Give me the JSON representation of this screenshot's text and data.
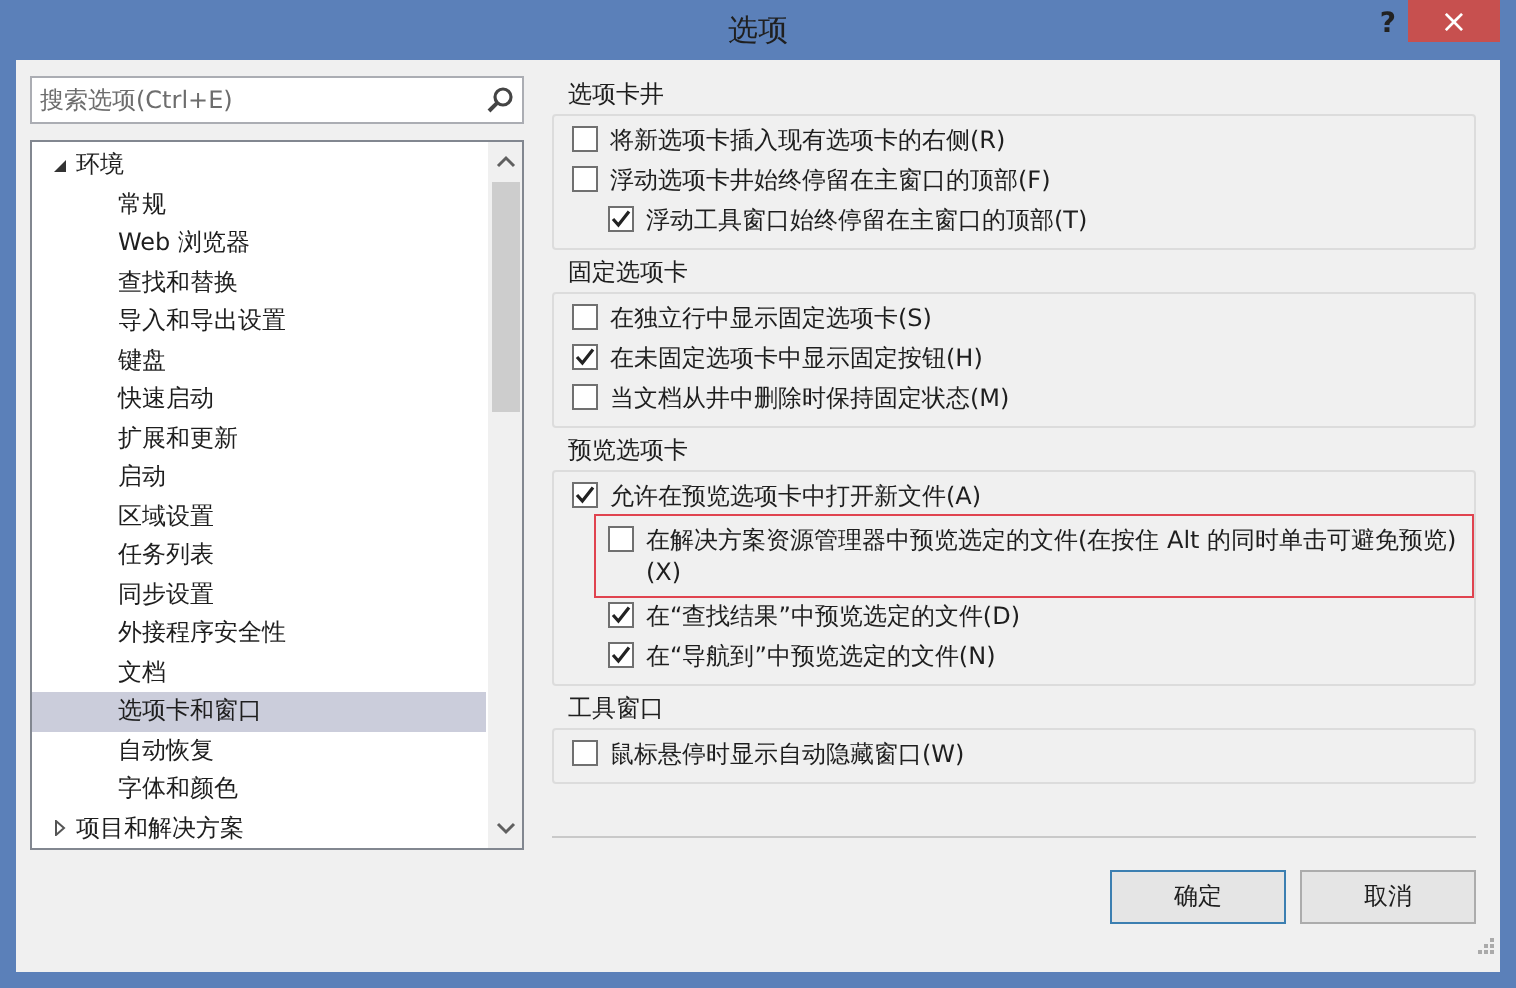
{
  "window": {
    "title": "选项",
    "help": "?",
    "close": "×"
  },
  "search": {
    "placeholder": "搜索选项(Ctrl+E)"
  },
  "tree": [
    {
      "label": "环境",
      "expanded": true,
      "children": [
        {
          "label": "常规",
          "selected": false
        },
        {
          "label": "Web 浏览器",
          "selected": false
        },
        {
          "label": "查找和替换",
          "selected": false
        },
        {
          "label": "导入和导出设置",
          "selected": false
        },
        {
          "label": "键盘",
          "selected": false
        },
        {
          "label": "快速启动",
          "selected": false
        },
        {
          "label": "扩展和更新",
          "selected": false
        },
        {
          "label": "启动",
          "selected": false
        },
        {
          "label": "区域设置",
          "selected": false
        },
        {
          "label": "任务列表",
          "selected": false
        },
        {
          "label": "同步设置",
          "selected": false
        },
        {
          "label": "外接程序安全性",
          "selected": false
        },
        {
          "label": "文档",
          "selected": false
        },
        {
          "label": "选项卡和窗口",
          "selected": true
        },
        {
          "label": "自动恢复",
          "selected": false
        },
        {
          "label": "字体和颜色",
          "selected": false
        }
      ]
    },
    {
      "label": "项目和解决方案",
      "expanded": false
    }
  ],
  "groups": [
    {
      "title": "选项卡井",
      "options": [
        {
          "label": "将新选项卡插入现有选项卡的右侧(R)",
          "checked": false,
          "highlighted": false
        },
        {
          "label": "浮动选项卡井始终停留在主窗口的顶部(F)",
          "checked": false,
          "highlighted": false,
          "children": [
            {
              "label": "浮动工具窗口始终停留在主窗口的顶部(T)",
              "checked": true,
              "highlighted": false
            }
          ]
        }
      ]
    },
    {
      "title": "固定选项卡",
      "options": [
        {
          "label": "在独立行中显示固定选项卡(S)",
          "checked": false,
          "highlighted": false
        },
        {
          "label": "在未固定选项卡中显示固定按钮(H)",
          "checked": true,
          "highlighted": false
        },
        {
          "label": "当文档从井中删除时保持固定状态(M)",
          "checked": false,
          "highlighted": false
        }
      ]
    },
    {
      "title": "预览选项卡",
      "options": [
        {
          "label": "允许在预览选项卡中打开新文件(A)",
          "checked": true,
          "highlighted": false,
          "children": [
            {
              "label": "在解决方案资源管理器中预览选定的文件(在按住 Alt 的同时单击可避免预览)(X)",
              "checked": false,
              "highlighted": true
            },
            {
              "label": "在“查找结果”中预览选定的文件(D)",
              "checked": true,
              "highlighted": false
            },
            {
              "label": "在“导航到”中预览选定的文件(N)",
              "checked": true,
              "highlighted": false
            }
          ]
        }
      ]
    },
    {
      "title": "工具窗口",
      "options": [
        {
          "label": "鼠标悬停时显示自动隐藏窗口(W)",
          "checked": false,
          "highlighted": false
        }
      ]
    }
  ],
  "buttons": [
    {
      "label": "确定",
      "default": true
    },
    {
      "label": "取消",
      "default": false
    }
  ]
}
